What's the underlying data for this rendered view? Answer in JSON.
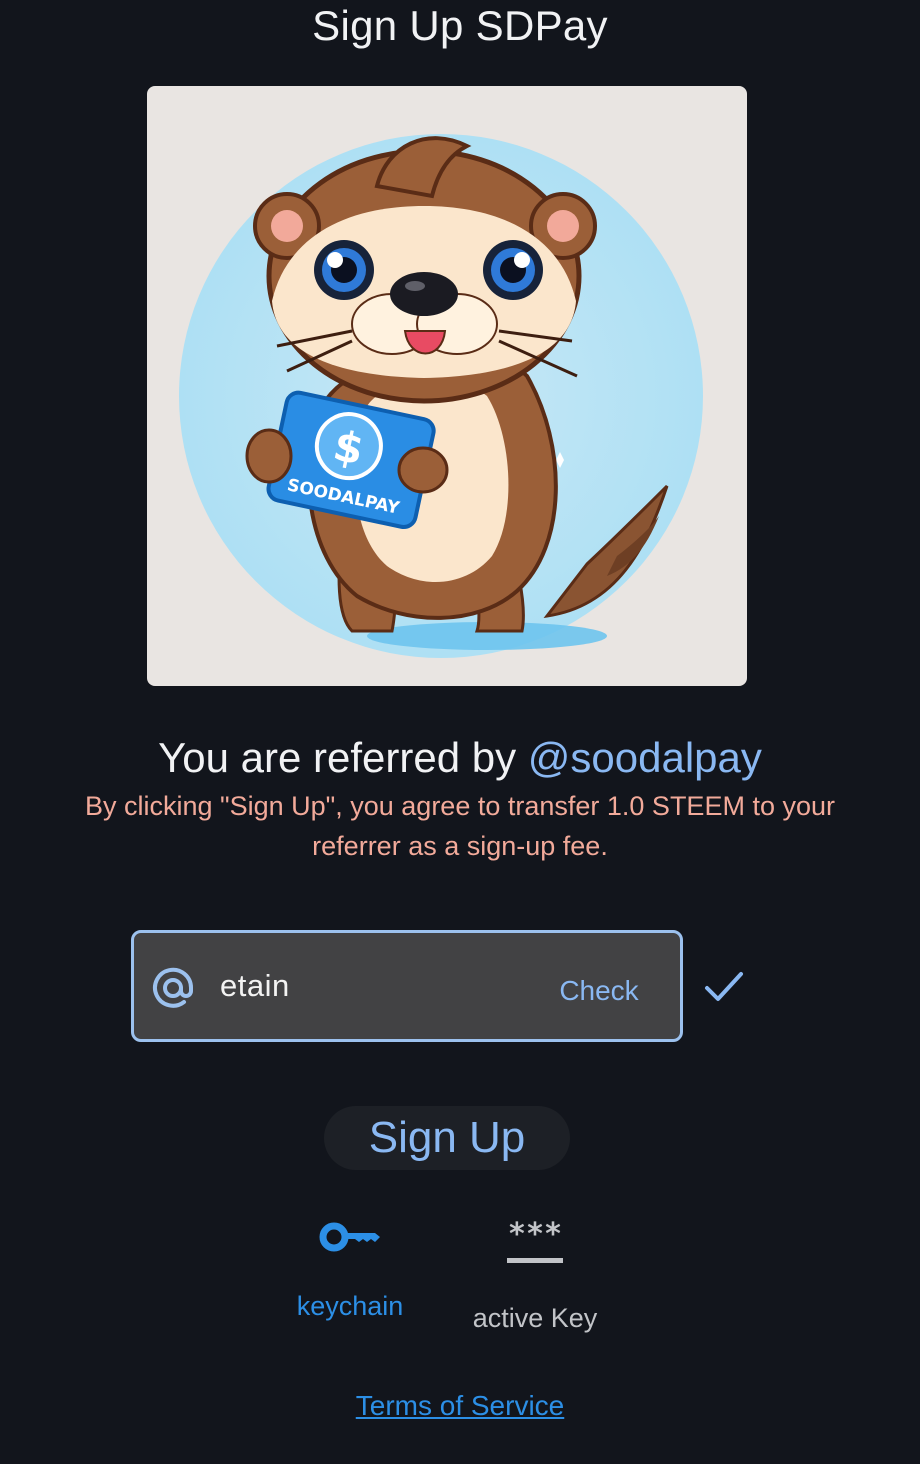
{
  "header": {
    "title": "Sign Up SDPay"
  },
  "hero": {
    "card_text": "SOODALPAY",
    "currency_symbol": "$"
  },
  "referral": {
    "prefix": "You are referred by ",
    "referrer": "@soodalpay"
  },
  "notice": {
    "fee_text": "By clicking \"Sign Up\", you agree to transfer 1.0 STEEM to your referrer as a sign-up fee."
  },
  "username_field": {
    "value": "etain",
    "check_label": "Check",
    "status": "valid"
  },
  "signup": {
    "button_label": "Sign Up"
  },
  "login_methods": [
    {
      "label": "keychain",
      "icon": "key-icon",
      "selected": true
    },
    {
      "label": "active Key",
      "icon": "password-icon",
      "selected": false
    }
  ],
  "footer": {
    "tos_label": "Terms of Service"
  },
  "colors": {
    "background": "#12151c",
    "accent": "#8ab8f2",
    "link": "#2c8fe6",
    "notice": "#f2aa9a",
    "input_background": "#424244"
  }
}
